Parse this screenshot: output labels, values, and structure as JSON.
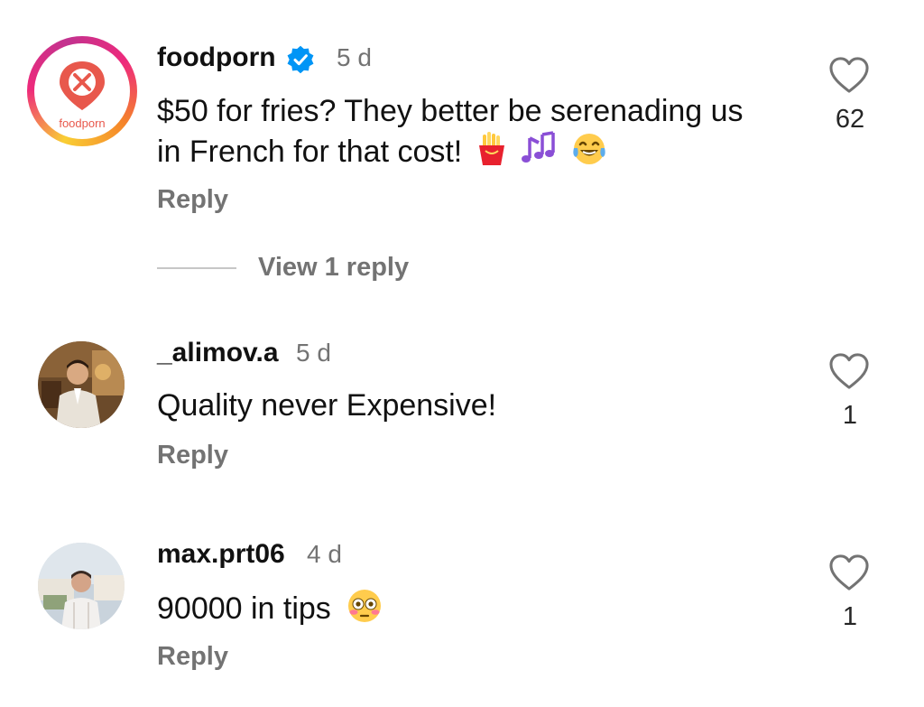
{
  "comments": [
    {
      "username": "foodporn",
      "verified": true,
      "time": "5 d",
      "text_line1": "$50 for fries? They better be serenading us",
      "text_line2": "in French for that cost!",
      "emojis": [
        "fries-emoji",
        "musical-notes-emoji",
        "tears-of-joy-emoji"
      ],
      "avatar_label": "foodporn",
      "reply_label": "Reply",
      "likes": "62",
      "view_replies_label": "View 1 reply"
    },
    {
      "username": "_alimov.a",
      "time": "5 d",
      "text": "Quality never Expensive!",
      "reply_label": "Reply",
      "likes": "1"
    },
    {
      "username": "max.prt06",
      "time": "4 d",
      "text": "90000 in tips",
      "emojis": [
        "flushed-face-emoji"
      ],
      "reply_label": "Reply",
      "likes": "1"
    }
  ],
  "colors": {
    "secondary_text": "#737373",
    "verified_blue": "#0095f6",
    "brand_red": "#e8584c"
  }
}
